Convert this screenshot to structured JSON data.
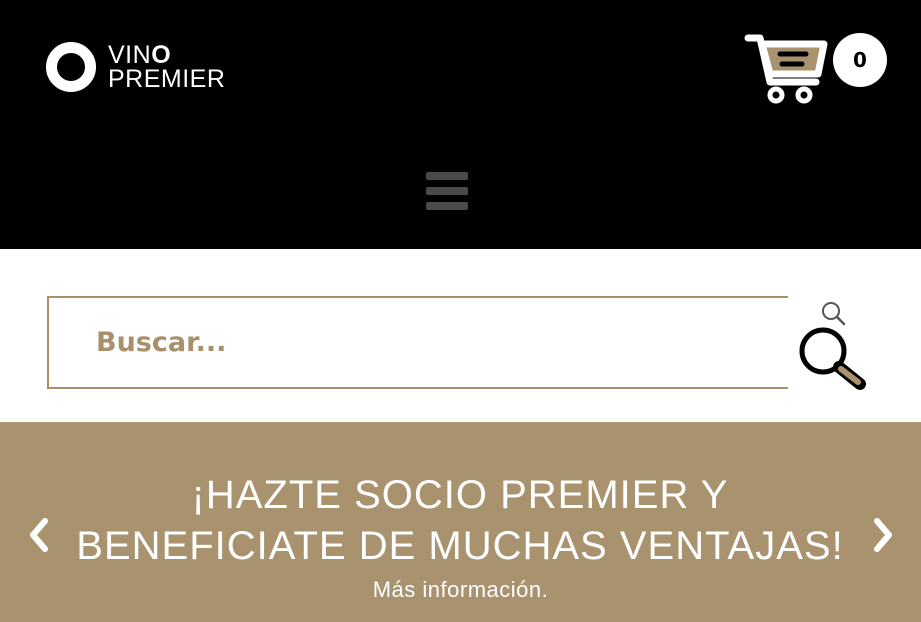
{
  "header": {
    "logo": {
      "line1_thin": "VIN",
      "line1_bold": "O",
      "line2": "PREMIER"
    },
    "cart": {
      "count": "0",
      "icon": "shopping-cart-icon"
    },
    "menu": {
      "icon": "hamburger-menu-icon"
    }
  },
  "search": {
    "placeholder": "Buscar...",
    "value": "",
    "icon": "search-icon"
  },
  "banner": {
    "title": "¡HAZTE SOCIO PREMIER Y BENEFICIATE DE MUCHAS VENTAJAS!",
    "link_text": "Más información.",
    "prev_icon": "chevron-left-icon",
    "next_icon": "chevron-right-icon"
  },
  "colors": {
    "header_bg": "#000000",
    "brand_gold": "#a8936e",
    "search_border": "#a8906b",
    "menu_gray": "#4a4a4a"
  }
}
